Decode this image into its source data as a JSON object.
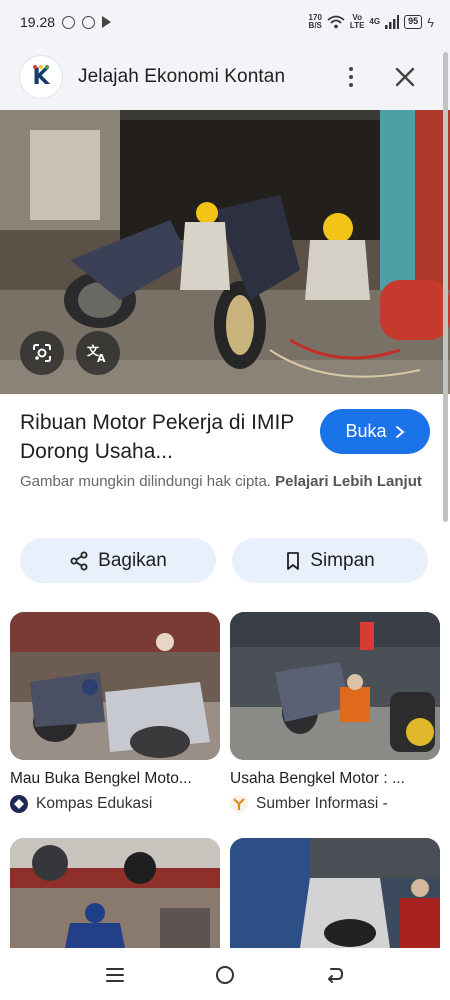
{
  "status": {
    "time": "19.28",
    "net_speed_value": "170",
    "net_speed_unit": "B/S",
    "volte_top": "Vo",
    "volte_bottom": "LTE",
    "network": "4G",
    "battery": "95"
  },
  "header": {
    "title": "Jelajah Ekonomi Kontan",
    "logo_letter": "K"
  },
  "article": {
    "title": "Ribuan Motor Pekerja di IMIP Dorong Usaha...",
    "open_button": "Buka",
    "copyright_text": "Gambar mungkin dilindungi hak cipta.",
    "learn_more": "Pelajari Lebih Lanjut"
  },
  "actions": {
    "share_label": "Bagikan",
    "save_label": "Simpan"
  },
  "related": [
    {
      "title": "Mau Buka Bengkel Moto...",
      "source": "Kompas Edukasi",
      "source_icon": "kompas-logo-icon"
    },
    {
      "title": "Usaha Bengkel Motor : ...",
      "source": "Sumber Informasi -",
      "source_icon": "sumber-informasi-logo-icon"
    }
  ],
  "colors": {
    "accent": "#1a73e8",
    "chip_bg": "#e8f0fc",
    "header_bg": "#f3f4f7"
  }
}
